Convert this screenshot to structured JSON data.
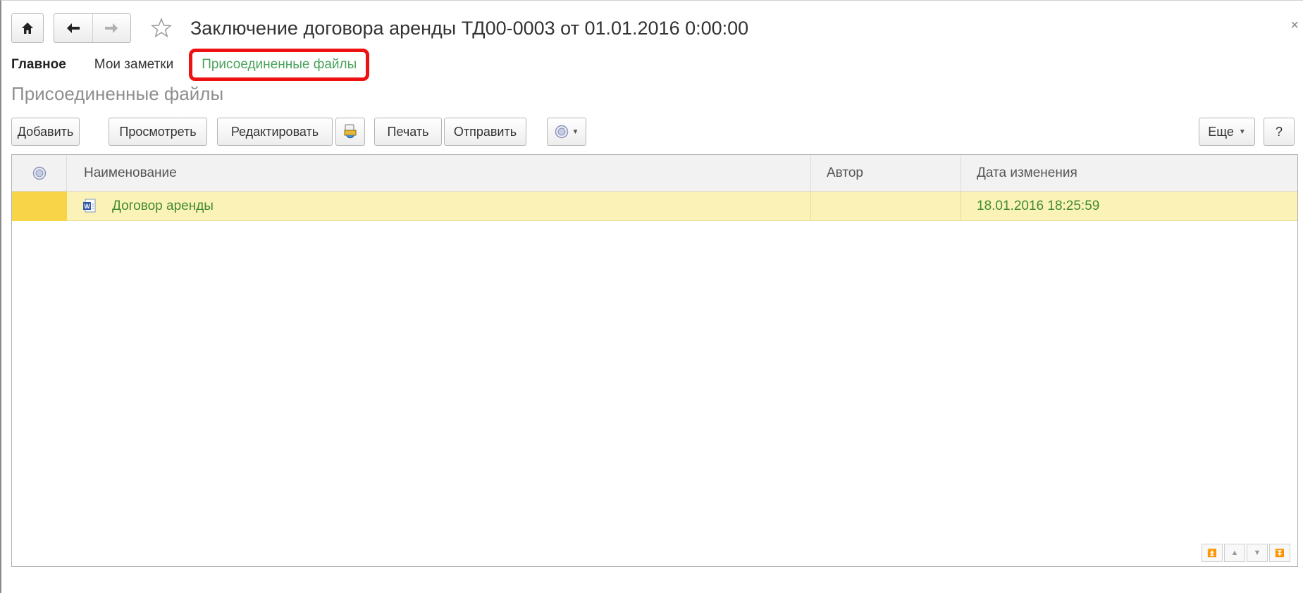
{
  "window": {
    "title": "Заключение договора аренды ТД00-0003 от 01.01.2016 0:00:00",
    "close_glyph": "×"
  },
  "tabs": [
    {
      "label": "Главное",
      "state": "active"
    },
    {
      "label": "Мои заметки",
      "state": "normal"
    },
    {
      "label": "Присоединенные файлы",
      "state": "current",
      "highlight_color": "#ee1111"
    }
  ],
  "section_title": "Присоединенные файлы",
  "toolbar": {
    "add_label": "Добавить",
    "view_label": "Просмотреть",
    "edit_label": "Редактировать",
    "print_label": "Печать",
    "send_label": "Отправить",
    "more_label": "Еще",
    "help_label": "?",
    "scan_icon": "scanner-icon",
    "status_icon": "circle-status-icon"
  },
  "table": {
    "columns": [
      "Наименование",
      "Автор",
      "Дата изменения"
    ],
    "rows": [
      {
        "name": "Договор аренды",
        "author": "",
        "modified": "18.01.2016 18:25:59",
        "icon": "word-document-icon"
      }
    ]
  },
  "colors": {
    "accent_green": "#4aa35c",
    "selected_row": "#fbf2b8",
    "row_marker": "#f8d548",
    "highlight": "#ee1111"
  }
}
